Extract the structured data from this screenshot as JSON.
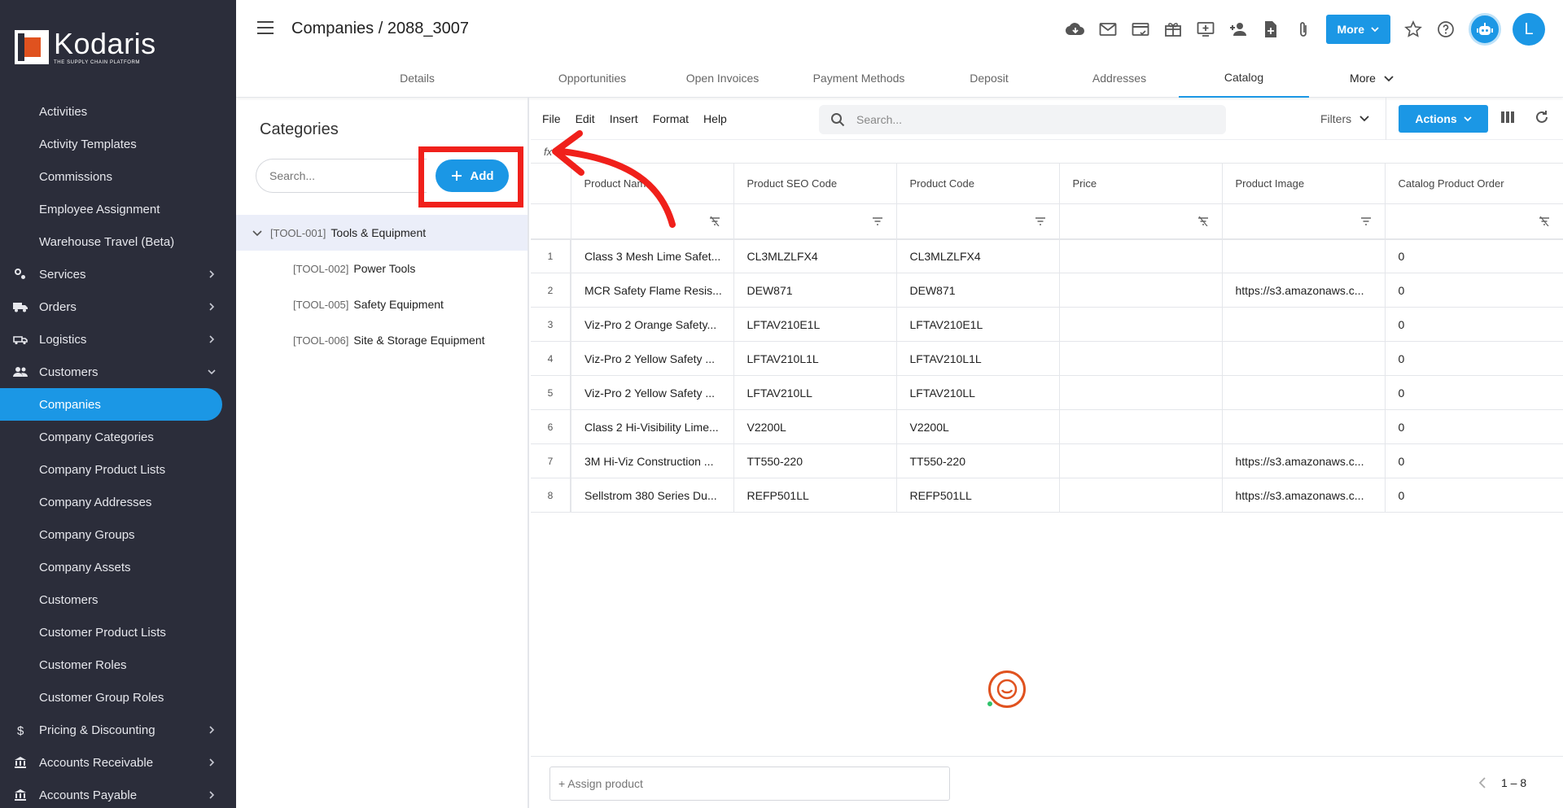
{
  "app": {
    "logo_name": "Kodaris",
    "logo_tagline": "THE SUPPLY CHAIN PLATFORM"
  },
  "sidebar": {
    "items": [
      {
        "label": "Activities",
        "kind": "sub"
      },
      {
        "label": "Activity Templates",
        "kind": "sub"
      },
      {
        "label": "Commissions",
        "kind": "sub"
      },
      {
        "label": "Employee Assignment",
        "kind": "sub"
      },
      {
        "label": "Warehouse Travel (Beta)",
        "kind": "sub"
      },
      {
        "label": "Services",
        "kind": "group",
        "icon": "services-icon",
        "expanded": false
      },
      {
        "label": "Orders",
        "kind": "group",
        "icon": "truck-icon",
        "expanded": false
      },
      {
        "label": "Logistics",
        "kind": "group",
        "icon": "shipping-icon",
        "expanded": false
      },
      {
        "label": "Customers",
        "kind": "group",
        "icon": "people-icon",
        "expanded": true
      },
      {
        "label": "Companies",
        "kind": "sub",
        "active": true
      },
      {
        "label": "Company Categories",
        "kind": "sub"
      },
      {
        "label": "Company Product Lists",
        "kind": "sub"
      },
      {
        "label": "Company Addresses",
        "kind": "sub"
      },
      {
        "label": "Company Groups",
        "kind": "sub"
      },
      {
        "label": "Company Assets",
        "kind": "sub"
      },
      {
        "label": "Customers",
        "kind": "sub"
      },
      {
        "label": "Customer Product Lists",
        "kind": "sub"
      },
      {
        "label": "Customer Roles",
        "kind": "sub"
      },
      {
        "label": "Customer Group Roles",
        "kind": "sub"
      },
      {
        "label": "Pricing & Discounting",
        "kind": "group",
        "icon": "dollar-icon",
        "expanded": false
      },
      {
        "label": "Accounts Receivable",
        "kind": "group",
        "icon": "bank-icon",
        "expanded": false
      },
      {
        "label": "Accounts Payable",
        "kind": "group",
        "icon": "bank-icon",
        "expanded": false
      }
    ]
  },
  "header": {
    "breadcrumb": "Companies / 2088_3007",
    "more_label": "More",
    "avatar_initial": "L"
  },
  "tabs": [
    {
      "label": "Details",
      "active": false
    },
    {
      "label": "Opportunities",
      "active": false
    },
    {
      "label": "Open Invoices",
      "active": false
    },
    {
      "label": "Payment Methods",
      "active": false
    },
    {
      "label": "Deposit",
      "active": false
    },
    {
      "label": "Addresses",
      "active": false
    },
    {
      "label": "Catalog",
      "active": true
    },
    {
      "label": "More",
      "active": false
    }
  ],
  "categories": {
    "title": "Categories",
    "search_placeholder": "Search...",
    "add_label": "Add",
    "tree": [
      {
        "code": "[TOOL-001]",
        "label": "Tools & Equipment",
        "level": 0,
        "expanded": true,
        "selected": true
      },
      {
        "code": "[TOOL-002]",
        "label": "Power Tools",
        "level": 1
      },
      {
        "code": "[TOOL-005]",
        "label": "Safety Equipment",
        "level": 1
      },
      {
        "code": "[TOOL-006]",
        "label": "Site & Storage Equipment",
        "level": 1
      }
    ]
  },
  "grid": {
    "menu": [
      "File",
      "Edit",
      "Insert",
      "Format",
      "Help"
    ],
    "search_placeholder": "Search...",
    "filters_label": "Filters",
    "actions_label": "Actions",
    "fx_label": "fx",
    "columns": [
      "Product Name",
      "Product SEO Code",
      "Product Code",
      "Price",
      "Product Image",
      "Catalog Product Order"
    ],
    "rows": [
      {
        "n": "1",
        "name": "Class 3 Mesh Lime Safet...",
        "seo": "CL3MLZLFX4",
        "code": "CL3MLZLFX4",
        "price": "",
        "image": "",
        "order": "0"
      },
      {
        "n": "2",
        "name": "MCR Safety Flame Resis...",
        "seo": "DEW871",
        "code": "DEW871",
        "price": "",
        "image": "https://s3.amazonaws.c...",
        "order": "0"
      },
      {
        "n": "3",
        "name": "Viz-Pro 2 Orange Safety...",
        "seo": "LFTAV210E1L",
        "code": "LFTAV210E1L",
        "price": "",
        "image": "",
        "order": "0"
      },
      {
        "n": "4",
        "name": "Viz-Pro 2 Yellow Safety ...",
        "seo": "LFTAV210L1L",
        "code": "LFTAV210L1L",
        "price": "",
        "image": "",
        "order": "0"
      },
      {
        "n": "5",
        "name": "Viz-Pro 2 Yellow Safety ...",
        "seo": "LFTAV210LL",
        "code": "LFTAV210LL",
        "price": "",
        "image": "",
        "order": "0"
      },
      {
        "n": "6",
        "name": "Class 2 Hi-Visibility Lime...",
        "seo": "V2200L",
        "code": "V2200L",
        "price": "",
        "image": "",
        "order": "0"
      },
      {
        "n": "7",
        "name": "3M Hi-Viz Construction ...",
        "seo": "TT550-220",
        "code": "TT550-220",
        "price": "",
        "image": "https://s3.amazonaws.c...",
        "order": "0"
      },
      {
        "n": "8",
        "name": "Sellstrom 380 Series Du...",
        "seo": "REFP501LL",
        "code": "REFP501LL",
        "price": "",
        "image": "https://s3.amazonaws.c...",
        "order": "0"
      }
    ],
    "assign_placeholder": "+ Assign product",
    "pager_text": "1 – 8"
  },
  "colors": {
    "accent": "#1b97e5",
    "sidebar_bg": "#2b2d3a",
    "annotation_red": "#f0201b",
    "brand_orange": "#e0521f"
  }
}
